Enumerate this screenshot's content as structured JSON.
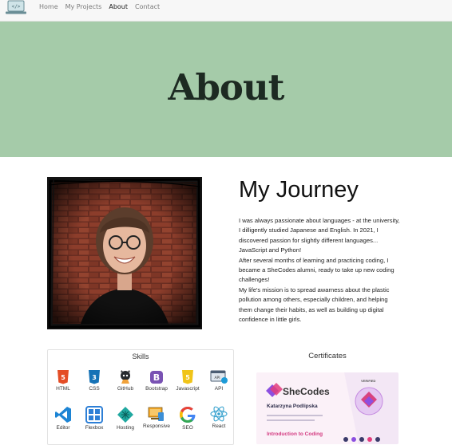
{
  "nav": {
    "logo_icon": "laptop-code-icon",
    "links": [
      {
        "label": "Home",
        "active": false
      },
      {
        "label": "My Projects",
        "active": false
      },
      {
        "label": "About",
        "active": true
      },
      {
        "label": "Contact",
        "active": false
      }
    ]
  },
  "hero": {
    "title": "About",
    "background": "#a5cba9"
  },
  "journey": {
    "title": "My Journey",
    "lines": [
      "I was always passionate about languages - at the university,",
      "I dilligently studied Japanese and English. In 2021, I",
      "discovered passion for slightly different languages...",
      "JavaScript and Python!",
      "After several months of learning and practicing coding, I",
      "became a SheCodes alumni, ready to take up new coding",
      "challenges!",
      "My life's mission is to spread awarness about the plastic",
      "pollution among others, especially children, and helping",
      "them change their habits, as well as building up digital",
      "confidence in little girls."
    ]
  },
  "skills": {
    "title": "Skills",
    "items": [
      {
        "label": "HTML",
        "icon": "html5-icon"
      },
      {
        "label": "CSS",
        "icon": "css3-icon"
      },
      {
        "label": "GitHub",
        "icon": "github-icon"
      },
      {
        "label": "Bootstrap",
        "icon": "bootstrap-icon"
      },
      {
        "label": "Javascript",
        "icon": "javascript-icon"
      },
      {
        "label": "API",
        "icon": "api-icon"
      },
      {
        "label": "Editor",
        "icon": "vscode-icon"
      },
      {
        "label": "Flexbox",
        "icon": "flexbox-icon"
      },
      {
        "label": "Hosting",
        "icon": "hosting-icon"
      },
      {
        "label": "Responsive",
        "icon": "responsive-icon"
      },
      {
        "label": "SEO",
        "icon": "google-icon"
      },
      {
        "label": "React",
        "icon": "react-icon"
      }
    ]
  },
  "certificates": {
    "title": "Certificates",
    "brand": "SheCodes",
    "name": "Katarzyna Podlipska",
    "course": "Introduction to Coding",
    "badge": "VERIFIED"
  }
}
